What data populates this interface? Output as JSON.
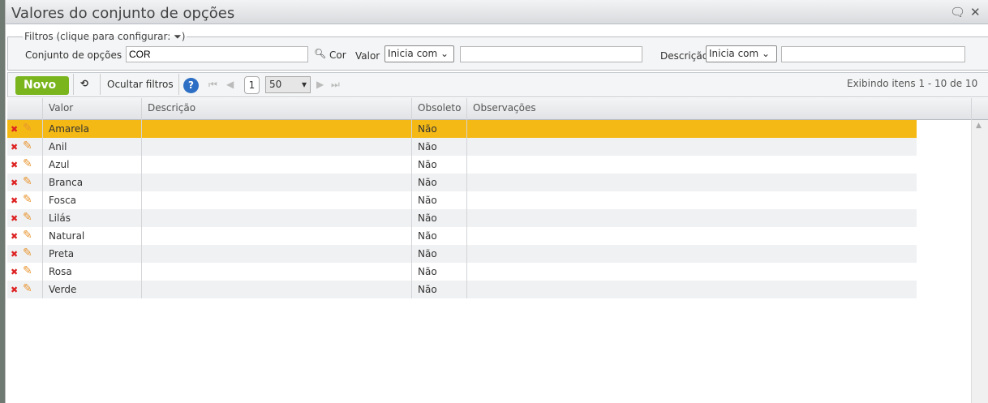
{
  "dialog": {
    "title": "Valores do conjunto de opções"
  },
  "filters": {
    "legend": "Filtros (clique para configurar:",
    "legend_end": ")",
    "conjunto_label": "Conjunto de opções",
    "conjunto_value": "COR",
    "conjunto_desc": "Cor",
    "valor_label": "Valor",
    "valor_op": "Inicia com",
    "valor_value": "",
    "descricao_label": "Descrição",
    "descricao_op": "Inicia com",
    "descricao_value": ""
  },
  "toolbar": {
    "new": "Novo",
    "hide_filters": "Ocultar filtros",
    "page": "1",
    "page_size": "50",
    "status": "Exibindo itens 1 - 10 de 10"
  },
  "table": {
    "columns": [
      "Valor",
      "Descrição",
      "Obsoleto",
      "Observações"
    ],
    "rows": [
      {
        "valor": "Amarela",
        "descricao": "",
        "obsoleto": "Não",
        "obs": ""
      },
      {
        "valor": "Anil",
        "descricao": "",
        "obsoleto": "Não",
        "obs": ""
      },
      {
        "valor": "Azul",
        "descricao": "",
        "obsoleto": "Não",
        "obs": ""
      },
      {
        "valor": "Branca",
        "descricao": "",
        "obsoleto": "Não",
        "obs": ""
      },
      {
        "valor": "Fosca",
        "descricao": "",
        "obsoleto": "Não",
        "obs": ""
      },
      {
        "valor": "Lilás",
        "descricao": "",
        "obsoleto": "Não",
        "obs": ""
      },
      {
        "valor": "Natural",
        "descricao": "",
        "obsoleto": "Não",
        "obs": ""
      },
      {
        "valor": "Preta",
        "descricao": "",
        "obsoleto": "Não",
        "obs": ""
      },
      {
        "valor": "Rosa",
        "descricao": "",
        "obsoleto": "Não",
        "obs": ""
      },
      {
        "valor": "Verde",
        "descricao": "",
        "obsoleto": "Não",
        "obs": ""
      }
    ]
  },
  "colors": {
    "selected_row": "#f4b915",
    "alt_row": "#f0f1f3",
    "new_button": "#7ab51d"
  }
}
